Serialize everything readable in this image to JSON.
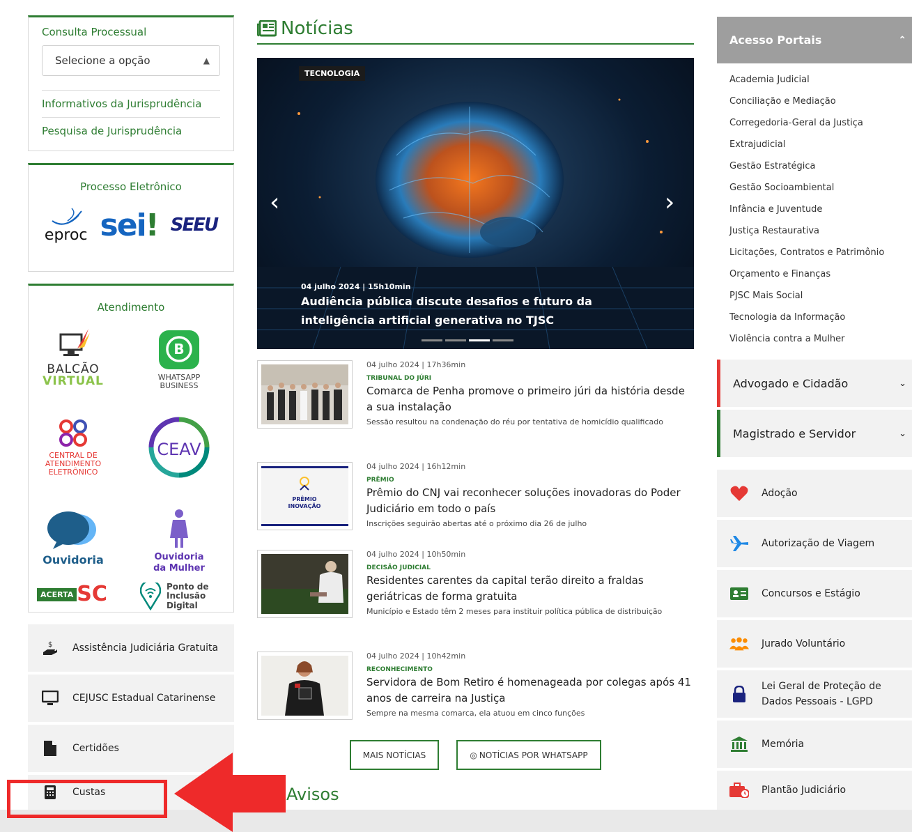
{
  "left": {
    "consulta_title": "Consulta Processual",
    "select_value": "Selecione a opção",
    "link_informativos": "Informativos da Jurisprudência",
    "link_pesquisa": "Pesquisa de Jurisprudência",
    "processo_title": "Processo Eletrônico",
    "eproc_label": "eproc",
    "sei_label": "sei",
    "seeu_label": "SEEU",
    "atendimento_title": "Atendimento",
    "balcao_line1": "BALCÃO",
    "balcao_line2": "VIRTUAL",
    "whatsapp_line1": "WHATSAPP",
    "whatsapp_line2": "BUSINESS",
    "central_line1": "CENTRAL DE",
    "central_line2": "ATENDIMENTO",
    "central_line3": "ELETRÔNICO",
    "ceav_label": "CEAV",
    "ouvidoria_label": "Ouvidoria",
    "ouvidoria_mulher_line1": "Ouvidoria",
    "ouvidoria_mulher_line2": "da Mulher",
    "acerta_label": "ACERTA",
    "acerta_sc": "SC",
    "ponto_line1": "Ponto de",
    "ponto_line2": "Inclusão",
    "ponto_line3": "Digital",
    "btn_assistencia": "Assistência Judiciária Gratuita",
    "btn_cejusc": "CEJUSC Estadual Catarinense",
    "btn_certidoes": "Certidões",
    "btn_custas": "Custas"
  },
  "center": {
    "section_title": "Notícias",
    "carousel": {
      "tag": "TECNOLOGIA",
      "date": "04 julho 2024 | 15h10min",
      "headline": "Audiência pública discute desafios e futuro da inteligência artificial generativa no TJSC"
    },
    "news": [
      {
        "meta": "04 julho 2024 | 17h36min",
        "category": "TRIBUNAL DO JÚRI",
        "title": "Comarca de Penha promove o primeiro júri da história desde a sua instalação",
        "subtitle": "Sessão resultou na condenação do réu por tentativa de homicídio qualificado"
      },
      {
        "meta": "04 julho 2024 | 16h12min",
        "category": "PRÊMIO",
        "title": "Prêmio do CNJ vai reconhecer soluções inovadoras do Poder Judiciário em todo o país",
        "subtitle": "Inscrições seguirão abertas até o próximo dia 26 de julho",
        "thumb_line1": "PRÊMIO",
        "thumb_line2": "INOVAÇÃO"
      },
      {
        "meta": "04 julho 2024 | 10h50min",
        "category": "DECISÃO JUDICIAL",
        "title": "Residentes carentes da capital terão direito a fraldas geriátricas de forma gratuita",
        "subtitle": "Município e Estado têm 2 meses para instituir política pública de distribuição"
      },
      {
        "meta": "04 julho 2024 | 10h42min",
        "category": "RECONHECIMENTO",
        "title": "Servidora de Bom Retiro é homenageada por colegas após 41 anos de carreira na Justiça",
        "subtitle": "Sempre na mesma comarca, ela atuou em cinco funções"
      }
    ],
    "btn_mais": "MAIS NOTÍCIAS",
    "btn_whatsapp": "NOTÍCIAS POR WHATSAPP",
    "avisos_title": "Avisos"
  },
  "right": {
    "acesso_title": "Acesso Portais",
    "portals": [
      "Academia Judicial",
      "Conciliação e Mediação",
      "Corregedoria-Geral da Justiça",
      "Extrajudicial",
      "Gestão Estratégica",
      "Gestão Socioambiental",
      "Infância e Juventude",
      "Justiça Restaurativa",
      "Licitações, Contratos e Patrimônio",
      "Orçamento e Finanças",
      "PJSC Mais Social",
      "Tecnologia da Informação",
      "Violência contra a Mulher"
    ],
    "advogado": "Advogado e Cidadão",
    "magistrado": "Magistrado e Servidor",
    "svc_adocao": "Adoção",
    "svc_viagem": "Autorização de Viagem",
    "svc_concursos": "Concursos e Estágio",
    "svc_jurado": "Jurado Voluntário",
    "svc_lgpd_line1": "Lei Geral de Proteção de",
    "svc_lgpd_line2": "Dados Pessoais - LGPD",
    "svc_memoria": "Memória",
    "svc_plantao": "Plantão Judiciário"
  },
  "colors": {
    "green": "#2e7d32",
    "annotation_red": "#ee2a2a",
    "accent_red": "#e53935"
  }
}
